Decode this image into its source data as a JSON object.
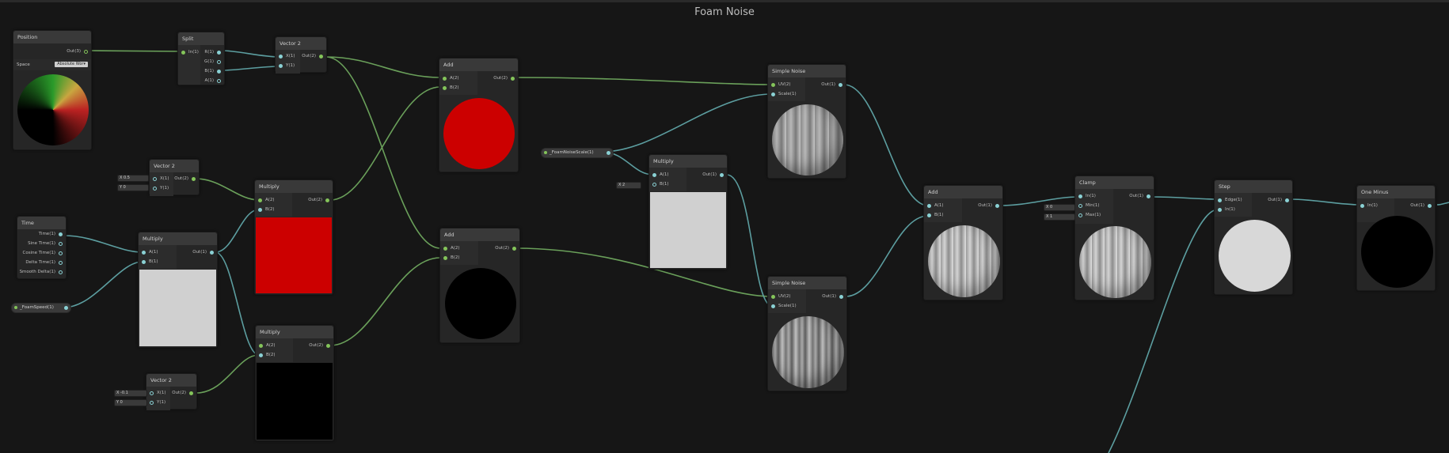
{
  "graph": {
    "title": "Foam Noise"
  },
  "colors": {
    "background": "#161616",
    "wire_green": "#6aa05a",
    "wire_cyan": "#5c9ea0",
    "node_header": "#393939"
  },
  "nodes": {
    "position": {
      "title": "Position",
      "out": "Out(3)",
      "space_label": "Space",
      "space_value": "Absolute Wor▾"
    },
    "split": {
      "title": "Split",
      "in": "In(1)",
      "outs": [
        "R(1)",
        "G(1)",
        "B(1)",
        "A(1)"
      ]
    },
    "vector2_top": {
      "title": "Vector 2",
      "ins": [
        "X(1)",
        "Y(1)"
      ],
      "out": "Out(2)"
    },
    "add_top": {
      "title": "Add",
      "ins": [
        "A(2)",
        "B(2)"
      ],
      "out": "Out(2)"
    },
    "simple_noise_top": {
      "title": "Simple Noise",
      "ins": [
        "UV(2)",
        "Scale(1)"
      ],
      "out": "Out(1)"
    },
    "foam_noise_scale": {
      "label": "_FoamNoiseScale(1)"
    },
    "multiply_scale": {
      "title": "Multiply",
      "ins": [
        "A(1)",
        "B(1)"
      ],
      "out": "Out(1)",
      "b_field": {
        "axis": "X",
        "value": "2"
      }
    },
    "vector2_mid": {
      "title": "Vector 2",
      "ins": [
        "X(1)",
        "Y(1)"
      ],
      "out": "Out(2)",
      "x_field": {
        "axis": "X",
        "value": "0.5"
      },
      "y_field": {
        "axis": "Y",
        "value": "0"
      }
    },
    "multiply_red": {
      "title": "Multiply",
      "ins": [
        "A(2)",
        "B(2)"
      ],
      "out": "Out(2)"
    },
    "time": {
      "title": "Time",
      "outs": [
        "Time(1)",
        "Sine Time(1)",
        "Cosine Time(1)",
        "Delta Time(1)",
        "Smooth Delta(1)"
      ]
    },
    "multiply_time": {
      "title": "Multiply",
      "ins": [
        "A(1)",
        "B(1)"
      ],
      "out": "Out(1)"
    },
    "foam_speed": {
      "label": "_FoamSpeed(1)"
    },
    "add_bottom": {
      "title": "Add",
      "ins": [
        "A(2)",
        "B(2)"
      ],
      "out": "Out(2)"
    },
    "simple_noise_bottom": {
      "title": "Simple Noise",
      "ins": [
        "UV(2)",
        "Scale(1)"
      ],
      "out": "Out(1)"
    },
    "multiply_black": {
      "title": "Multiply",
      "ins": [
        "A(2)",
        "B(2)"
      ],
      "out": "Out(2)"
    },
    "vector2_bottom": {
      "title": "Vector 2",
      "ins": [
        "X(1)",
        "Y(1)"
      ],
      "out": "Out(2)",
      "x_field": {
        "axis": "X",
        "value": "-0.1"
      },
      "y_field": {
        "axis": "Y",
        "value": "0"
      }
    },
    "add_right": {
      "title": "Add",
      "ins": [
        "A(1)",
        "B(1)"
      ],
      "out": "Out(1)"
    },
    "clamp": {
      "title": "Clamp",
      "ins": [
        "In(1)",
        "Min(1)",
        "Max(1)"
      ],
      "out": "Out(1)",
      "min_field": {
        "axis": "X",
        "value": "0"
      },
      "max_field": {
        "axis": "X",
        "value": "1"
      }
    },
    "step": {
      "title": "Step",
      "ins": [
        "Edge(1)",
        "In(1)"
      ],
      "out": "Out(1)"
    },
    "one_minus": {
      "title": "One Minus",
      "ins": [
        "In(1)"
      ],
      "out": "Out(1)"
    }
  }
}
